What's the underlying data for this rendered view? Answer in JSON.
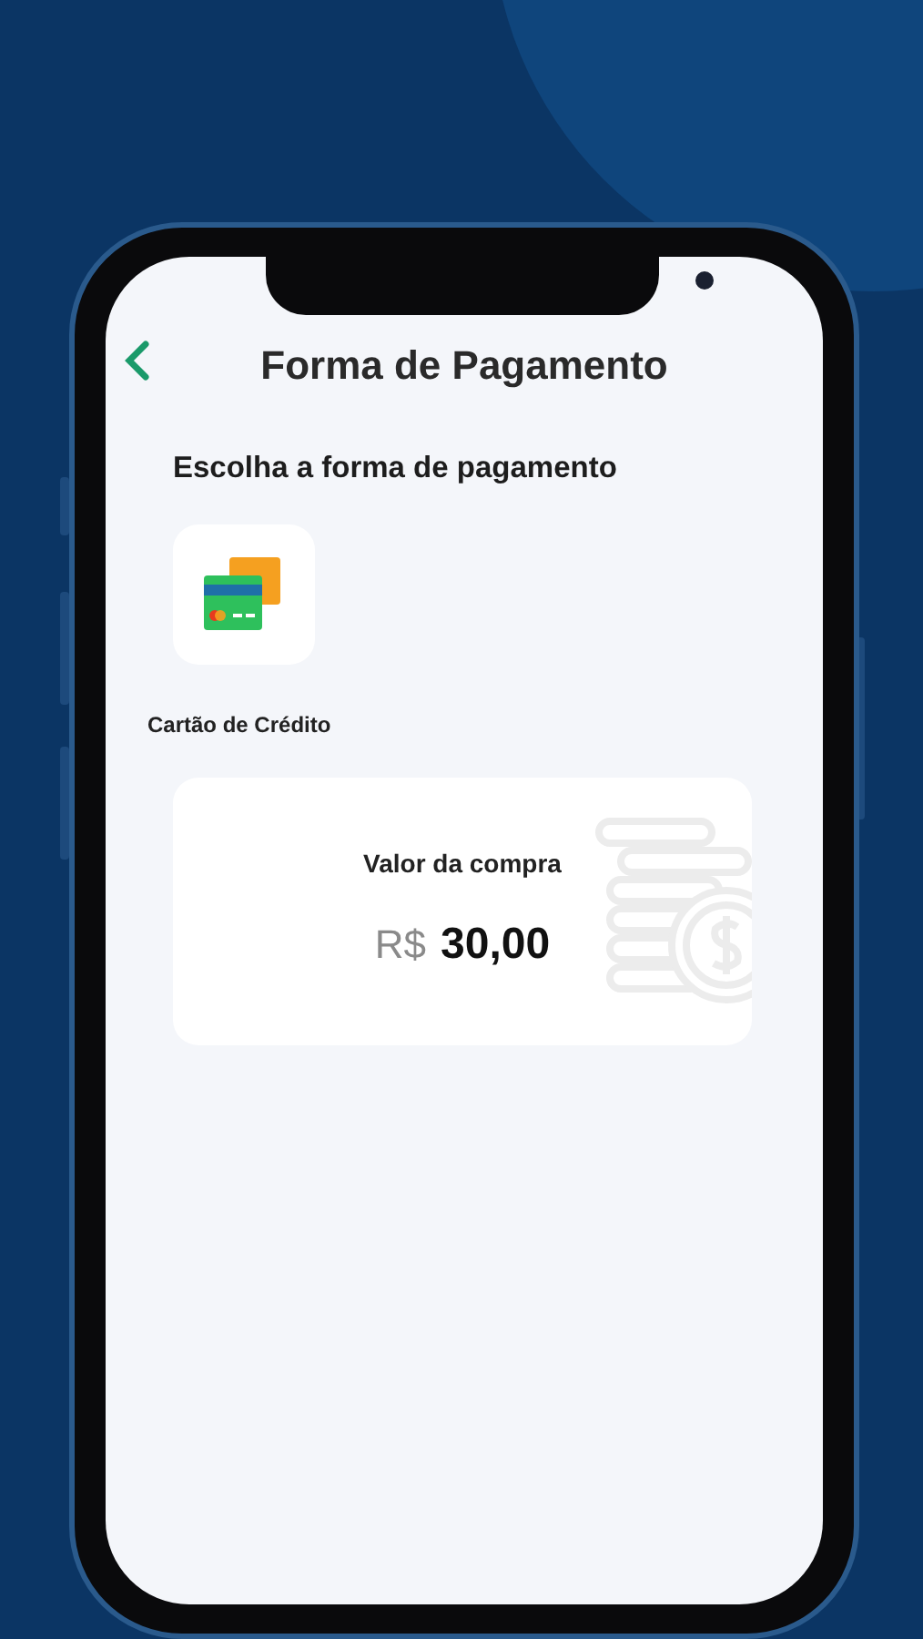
{
  "header": {
    "title": "Forma de Pagamento"
  },
  "section_title": "Escolha a forma de pagamento",
  "payment_methods": [
    {
      "label": "Cartão de Crédito",
      "kind": "card"
    }
  ],
  "purchase": {
    "label": "Valor da compra",
    "currency": "R$",
    "amount": "30,00"
  }
}
